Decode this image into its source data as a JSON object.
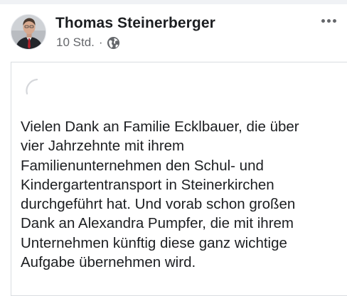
{
  "post": {
    "author": "Thomas Steinerberger",
    "timestamp": "10 Std.",
    "separator": "·",
    "audience_icon": "globe-icon",
    "more_icon": "more-options-icon",
    "text": "Vielen Dank an Familie Ecklbauer, die über\nvier Jahrzehnte mit ihrem\nFamilienunternehmen den Schul- und\nKindergartentransport in Steinerkirchen\ndurchgeführt hat. Und vorab schon großen\nDank an Alexandra Pumpfer, die mit ihrem\nUnternehmen künftig diese ganz wichtige\nAufgabe übernehmen wird."
  },
  "colors": {
    "text_primary": "#1c1e21",
    "text_secondary": "#65676b",
    "border": "#dadde1"
  }
}
